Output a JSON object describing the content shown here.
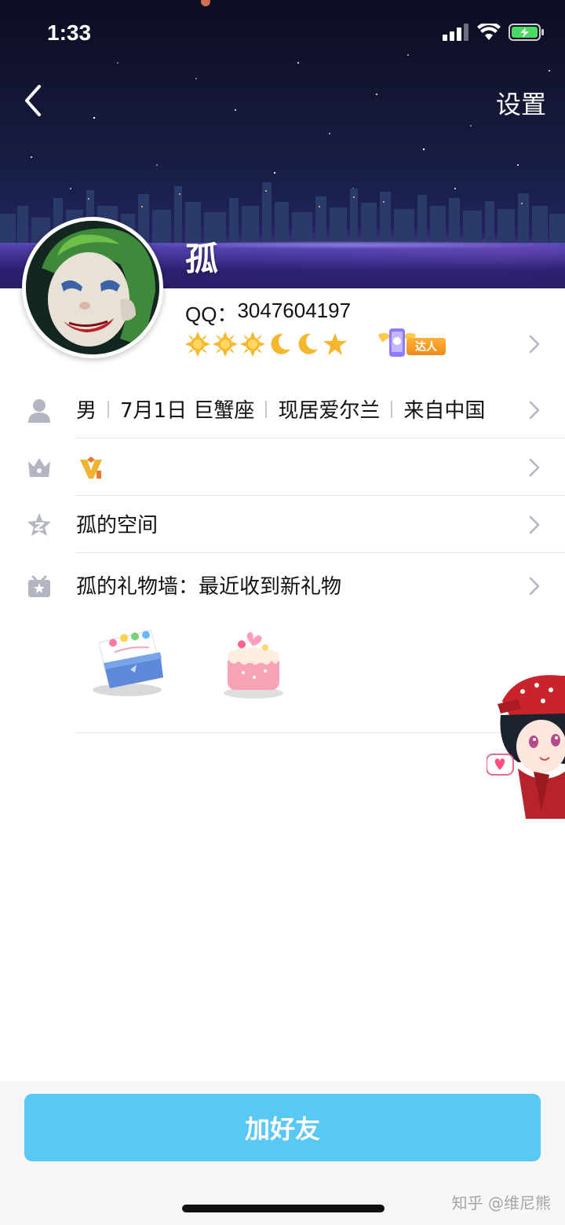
{
  "status_bar": {
    "time": "1:33",
    "battery_color": "#4cd964"
  },
  "header": {
    "settings_label": "设置"
  },
  "profile": {
    "nickname": "孤",
    "qq_label": "QQ：",
    "qq_number": "3047604197",
    "level_icons": [
      "sun-icon",
      "sun-icon",
      "sun-icon",
      "moon-icon",
      "moon-icon",
      "star-icon"
    ],
    "daren_label": "达人"
  },
  "info_rows": {
    "basic": {
      "gender": "男",
      "birthday": "7月1日 巨蟹座",
      "residence": "现居爱尔兰",
      "origin": "来自中国"
    },
    "vip_icon": "vip-badge-icon",
    "space_label": "孤的空间",
    "gift_wall_label": "孤的礼物墙：最近收到新礼物"
  },
  "gifts": [
    "birthday-card-gift",
    "cake-gift"
  ],
  "actions": {
    "add_friend_label": "加好友"
  },
  "watermark": "知乎 @维尼熊",
  "colors": {
    "accent": "#5ac8f5",
    "icon_gray": "#b3b5c3",
    "divider": "#e5e5e5"
  }
}
